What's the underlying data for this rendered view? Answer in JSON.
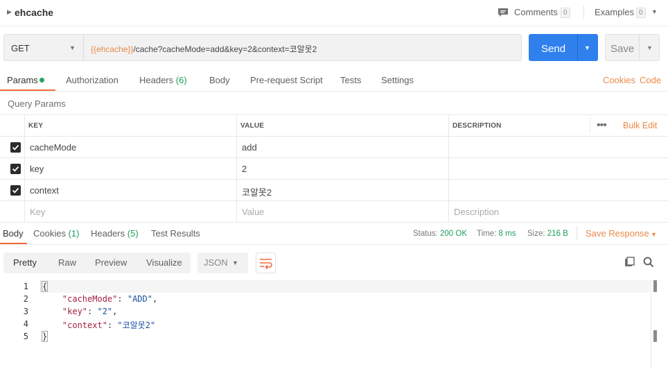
{
  "collection": {
    "name": "ehcache"
  },
  "topbar": {
    "comments_label": "Comments",
    "comments_count": "0",
    "examples_label": "Examples",
    "examples_count": "0"
  },
  "request": {
    "method": "GET",
    "url_variable": "{{ehcache}}",
    "url_rest": "/cache?cacheMode=add&key=2&context=코알못2",
    "send_label": "Send",
    "save_label": "Save"
  },
  "request_tabs": {
    "params": "Params",
    "authorization": "Authorization",
    "headers": "Headers",
    "headers_count": "(6)",
    "body": "Body",
    "prerequest": "Pre-request Script",
    "tests": "Tests",
    "settings": "Settings",
    "cookies": "Cookies",
    "code": "Code"
  },
  "query_params": {
    "title": "Query Params",
    "columns": {
      "key": "KEY",
      "value": "VALUE",
      "description": "DESCRIPTION"
    },
    "more": "•••",
    "bulk_edit": "Bulk Edit",
    "rows": [
      {
        "key": "cacheMode",
        "value": "add",
        "description": ""
      },
      {
        "key": "key",
        "value": "2",
        "description": ""
      },
      {
        "key": "context",
        "value": "코알못2",
        "description": ""
      }
    ],
    "placeholders": {
      "key": "Key",
      "value": "Value",
      "description": "Description"
    }
  },
  "response_tabs": {
    "body": "Body",
    "cookies": "Cookies",
    "cookies_count": "(1)",
    "headers": "Headers",
    "headers_count": "(5)",
    "test_results": "Test Results"
  },
  "response_meta": {
    "status_label": "Status:",
    "status_value": "200 OK",
    "time_label": "Time:",
    "time_value": "8 ms",
    "size_label": "Size:",
    "size_value": "216 B",
    "save_response": "Save Response"
  },
  "body_toolbar": {
    "views": [
      "Pretty",
      "Raw",
      "Preview",
      "Visualize"
    ],
    "format": "JSON"
  },
  "response_body": {
    "lines": [
      {
        "n": "1"
      },
      {
        "n": "2",
        "key": "\"cacheMode\"",
        "value": "\"ADD\""
      },
      {
        "n": "3",
        "key": "\"key\"",
        "value": "\"2\""
      },
      {
        "n": "4",
        "key": "\"context\"",
        "value": "\"코알못2\""
      },
      {
        "n": "5"
      }
    ],
    "open_brace": "{",
    "close_brace": "}"
  },
  "colors": {
    "accent": "#f26b3a",
    "link": "#e8894a",
    "send": "#2f80ed",
    "success": "#1e9e5a"
  }
}
